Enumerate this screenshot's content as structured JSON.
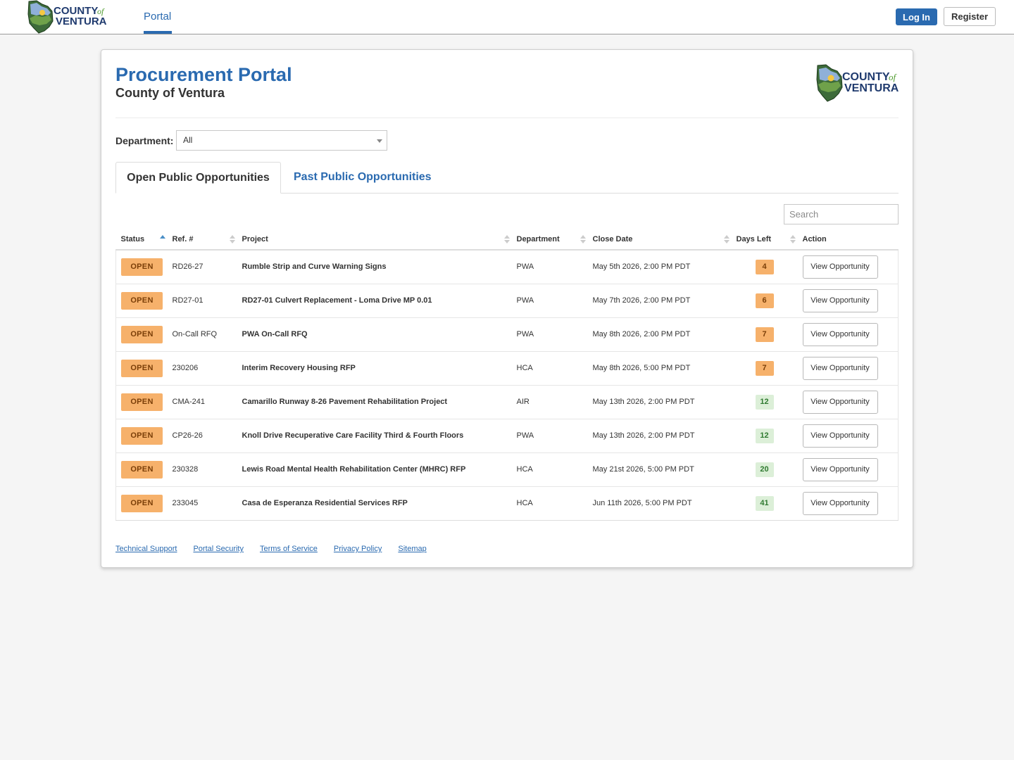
{
  "nav": {
    "logo_line1": "COUNTY",
    "logo_of": "of",
    "logo_line2": "VENTURA",
    "portal_link": "Portal",
    "login_label": "Log In",
    "register_label": "Register"
  },
  "header": {
    "title": "Procurement Portal",
    "subtitle": "County of Ventura"
  },
  "filter": {
    "department_label": "Department:",
    "department_value": "All"
  },
  "tabs": [
    {
      "label": "Open Public Opportunities",
      "active": true
    },
    {
      "label": "Past Public Opportunities",
      "active": false
    }
  ],
  "search": {
    "placeholder": "Search"
  },
  "table": {
    "columns": [
      "Status",
      "Ref. #",
      "Project",
      "Department",
      "Close Date",
      "Days Left",
      "Action"
    ],
    "rows": [
      {
        "status": "OPEN",
        "ref": "RD26-27",
        "project": "Rumble Strip and Curve Warning Signs",
        "dept": "PWA",
        "close": "May 5th 2026, 2:00 PM PDT",
        "days": "4",
        "urgent": true,
        "action": "View Opportunity"
      },
      {
        "status": "OPEN",
        "ref": "RD27-01",
        "project": "RD27-01 Culvert Replacement - Loma Drive MP 0.01",
        "dept": "PWA",
        "close": "May 7th 2026, 2:00 PM PDT",
        "days": "6",
        "urgent": true,
        "action": "View Opportunity"
      },
      {
        "status": "OPEN",
        "ref": "On-Call RFQ",
        "project": "PWA On-Call RFQ",
        "dept": "PWA",
        "close": "May 8th 2026, 2:00 PM PDT",
        "days": "7",
        "urgent": true,
        "action": "View Opportunity"
      },
      {
        "status": "OPEN",
        "ref": "230206",
        "project": "Interim Recovery Housing RFP",
        "dept": "HCA",
        "close": "May 8th 2026, 5:00 PM PDT",
        "days": "7",
        "urgent": true,
        "action": "View Opportunity"
      },
      {
        "status": "OPEN",
        "ref": "CMA-241",
        "project": "Camarillo Runway 8-26 Pavement Rehabilitation Project",
        "dept": "AIR",
        "close": "May 13th 2026, 2:00 PM PDT",
        "days": "12",
        "urgent": false,
        "action": "View Opportunity"
      },
      {
        "status": "OPEN",
        "ref": "CP26-26",
        "project": "Knoll Drive Recuperative Care Facility Third & Fourth Floors",
        "dept": "PWA",
        "close": "May 13th 2026, 2:00 PM PDT",
        "days": "12",
        "urgent": false,
        "action": "View Opportunity"
      },
      {
        "status": "OPEN",
        "ref": "230328",
        "project": "Lewis Road Mental Health Rehabilitation Center (MHRC) RFP",
        "dept": "HCA",
        "close": "May 21st 2026, 5:00 PM PDT",
        "days": "20",
        "urgent": false,
        "action": "View Opportunity"
      },
      {
        "status": "OPEN",
        "ref": "233045",
        "project": "Casa de Esperanza Residential Services RFP",
        "dept": "HCA",
        "close": "Jun 11th 2026, 5:00 PM PDT",
        "days": "41",
        "urgent": false,
        "action": "View Opportunity"
      }
    ]
  },
  "footer": {
    "links": [
      "Technical Support",
      "Portal Security",
      "Terms of Service",
      "Privacy Policy",
      "Sitemap"
    ]
  },
  "colors": {
    "brand_blue": "#2a6ab0",
    "status_orange": "#f6b16b",
    "days_ok_green": "#dcefd8"
  }
}
